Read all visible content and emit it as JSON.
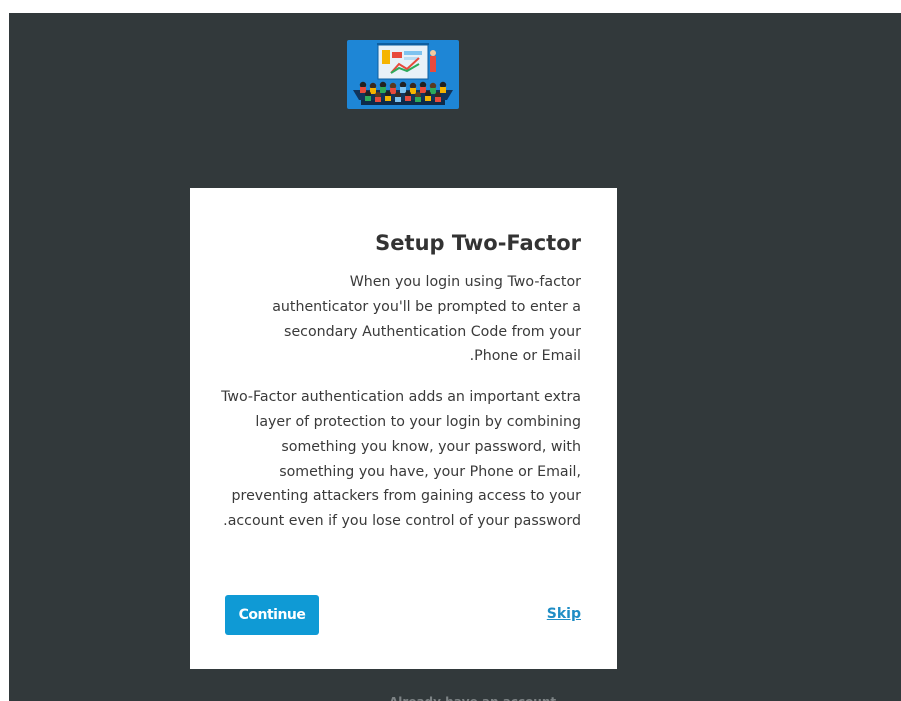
{
  "logo": {
    "icon": "conference-presentation-logo-icon"
  },
  "dialog": {
    "title": "Setup Two-Factor",
    "paragraph_1": "When you login using Two-factor authenticator you'll be prompted to enter a secondary Authentication Code from your Phone or Email.",
    "paragraph_2": "Two-Factor authentication adds an important extra layer of protection to your login by combining something you know, your password, with something you have, your Phone or Email, preventing attackers from gaining access to your account even if you lose control of your password.",
    "continue_label": "Continue",
    "skip_label": "Skip"
  },
  "footer": {
    "partial_text": "Already have an account"
  },
  "colors": {
    "background": "#32393b",
    "card": "#ffffff",
    "primary_button": "#0f9ad5",
    "link": "#1f8dc5"
  }
}
